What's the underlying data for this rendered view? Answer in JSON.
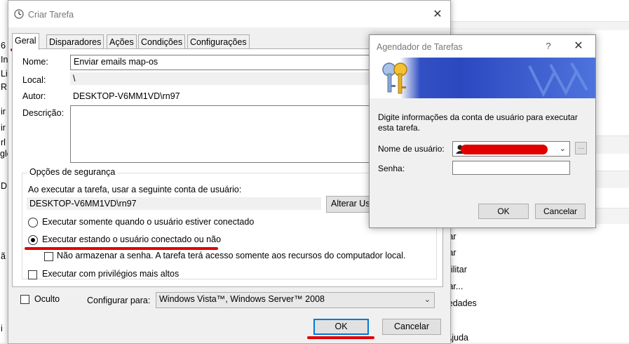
{
  "background": {
    "left_fragments": [
      "6",
      "In",
      "Li",
      "R",
      "ir",
      "ir",
      "rl",
      "gle",
      "D",
      "ã",
      "i"
    ],
    "right_actions": [
      "tar",
      "tar",
      "bilitar",
      "tar...",
      "iedades",
      "r",
      "Ajuda"
    ]
  },
  "main_dialog": {
    "title": "Criar Tarefa",
    "close_glyph": "✕",
    "tabs": [
      "Geral",
      "Disparadores",
      "Ações",
      "Condições",
      "Configurações"
    ],
    "name_label": "Nome:",
    "name_value": "Enviar emails map-os",
    "location_label": "Local:",
    "location_value": "\\",
    "author_label": "Autor:",
    "author_value": "DESKTOP-V6MM1VD\\rn97",
    "description_label": "Descrição:",
    "description_value": "",
    "security": {
      "legend": "Opções de segurança",
      "account_prompt": "Ao executar a tarefa, usar a seguinte conta de usuário:",
      "account_value": "DESKTOP-V6MM1VD\\rn97",
      "change_user_button": "Alterar Usuá",
      "radio_logged_on": "Executar somente quando o usuário estiver conectado",
      "radio_whether": "Executar estando o usuário conectado ou não",
      "selected_radio": "radio_whether",
      "no_store_password": "Não armazenar a senha. A tarefa terá acesso somente aos recursos do computador local.",
      "highest_privileges": "Executar com privilégios mais altos"
    },
    "hidden_label": "Oculto",
    "configure_label": "Configurar para:",
    "configure_value": "Windows Vista™, Windows Server™ 2008",
    "ok_button": "OK",
    "cancel_button": "Cancelar"
  },
  "scheduler_dialog": {
    "title": "Agendador de Tarefas",
    "help_glyph": "?",
    "close_glyph": "✕",
    "prompt": "Digite informações da conta de usuário para executar esta tarefa.",
    "username_label": "Nome de usuário:",
    "username_value": "",
    "password_label": "Senha:",
    "password_value": "",
    "browse_button": "...",
    "ok_button": "OK",
    "cancel_button": "Cancelar"
  },
  "colors": {
    "annotation_red": "#e10000",
    "default_button_border": "#0078d7",
    "banner_blue": "#2b48c0"
  }
}
